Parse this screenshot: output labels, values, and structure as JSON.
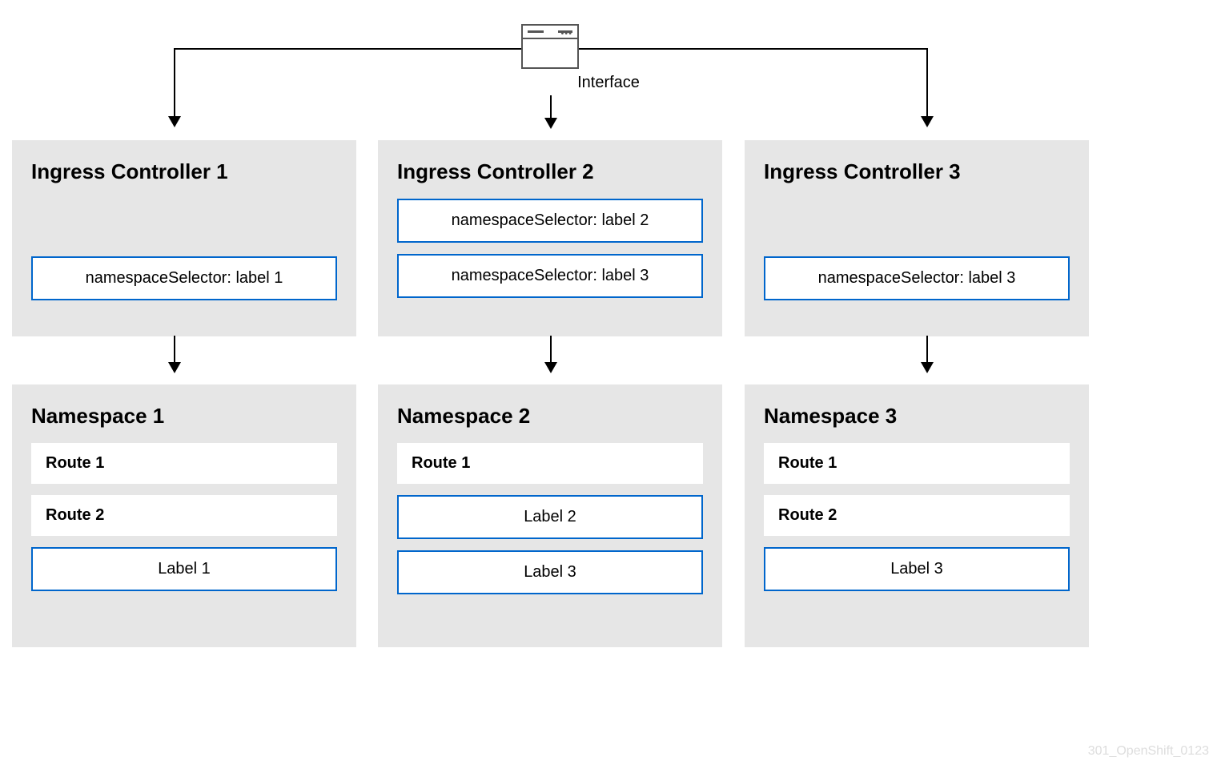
{
  "interface": {
    "label": "Interface"
  },
  "controllers": [
    {
      "title": "Ingress Controller 1",
      "selectors": [
        "namespaceSelector: label 1"
      ]
    },
    {
      "title": "Ingress Controller 2",
      "selectors": [
        "namespaceSelector: label 2",
        "namespaceSelector: label 3"
      ]
    },
    {
      "title": "Ingress Controller 3",
      "selectors": [
        "namespaceSelector: label 3"
      ]
    }
  ],
  "namespaces": [
    {
      "title": "Namespace 1",
      "routes": [
        "Route 1",
        "Route 2"
      ],
      "labels": [
        "Label 1"
      ]
    },
    {
      "title": "Namespace 2",
      "routes": [
        "Route 1"
      ],
      "labels": [
        "Label 2",
        "Label 3"
      ]
    },
    {
      "title": "Namespace 3",
      "routes": [
        "Route 1",
        "Route 2"
      ],
      "labels": [
        "Label 3"
      ]
    }
  ],
  "footer": "301_OpenShift_0123"
}
